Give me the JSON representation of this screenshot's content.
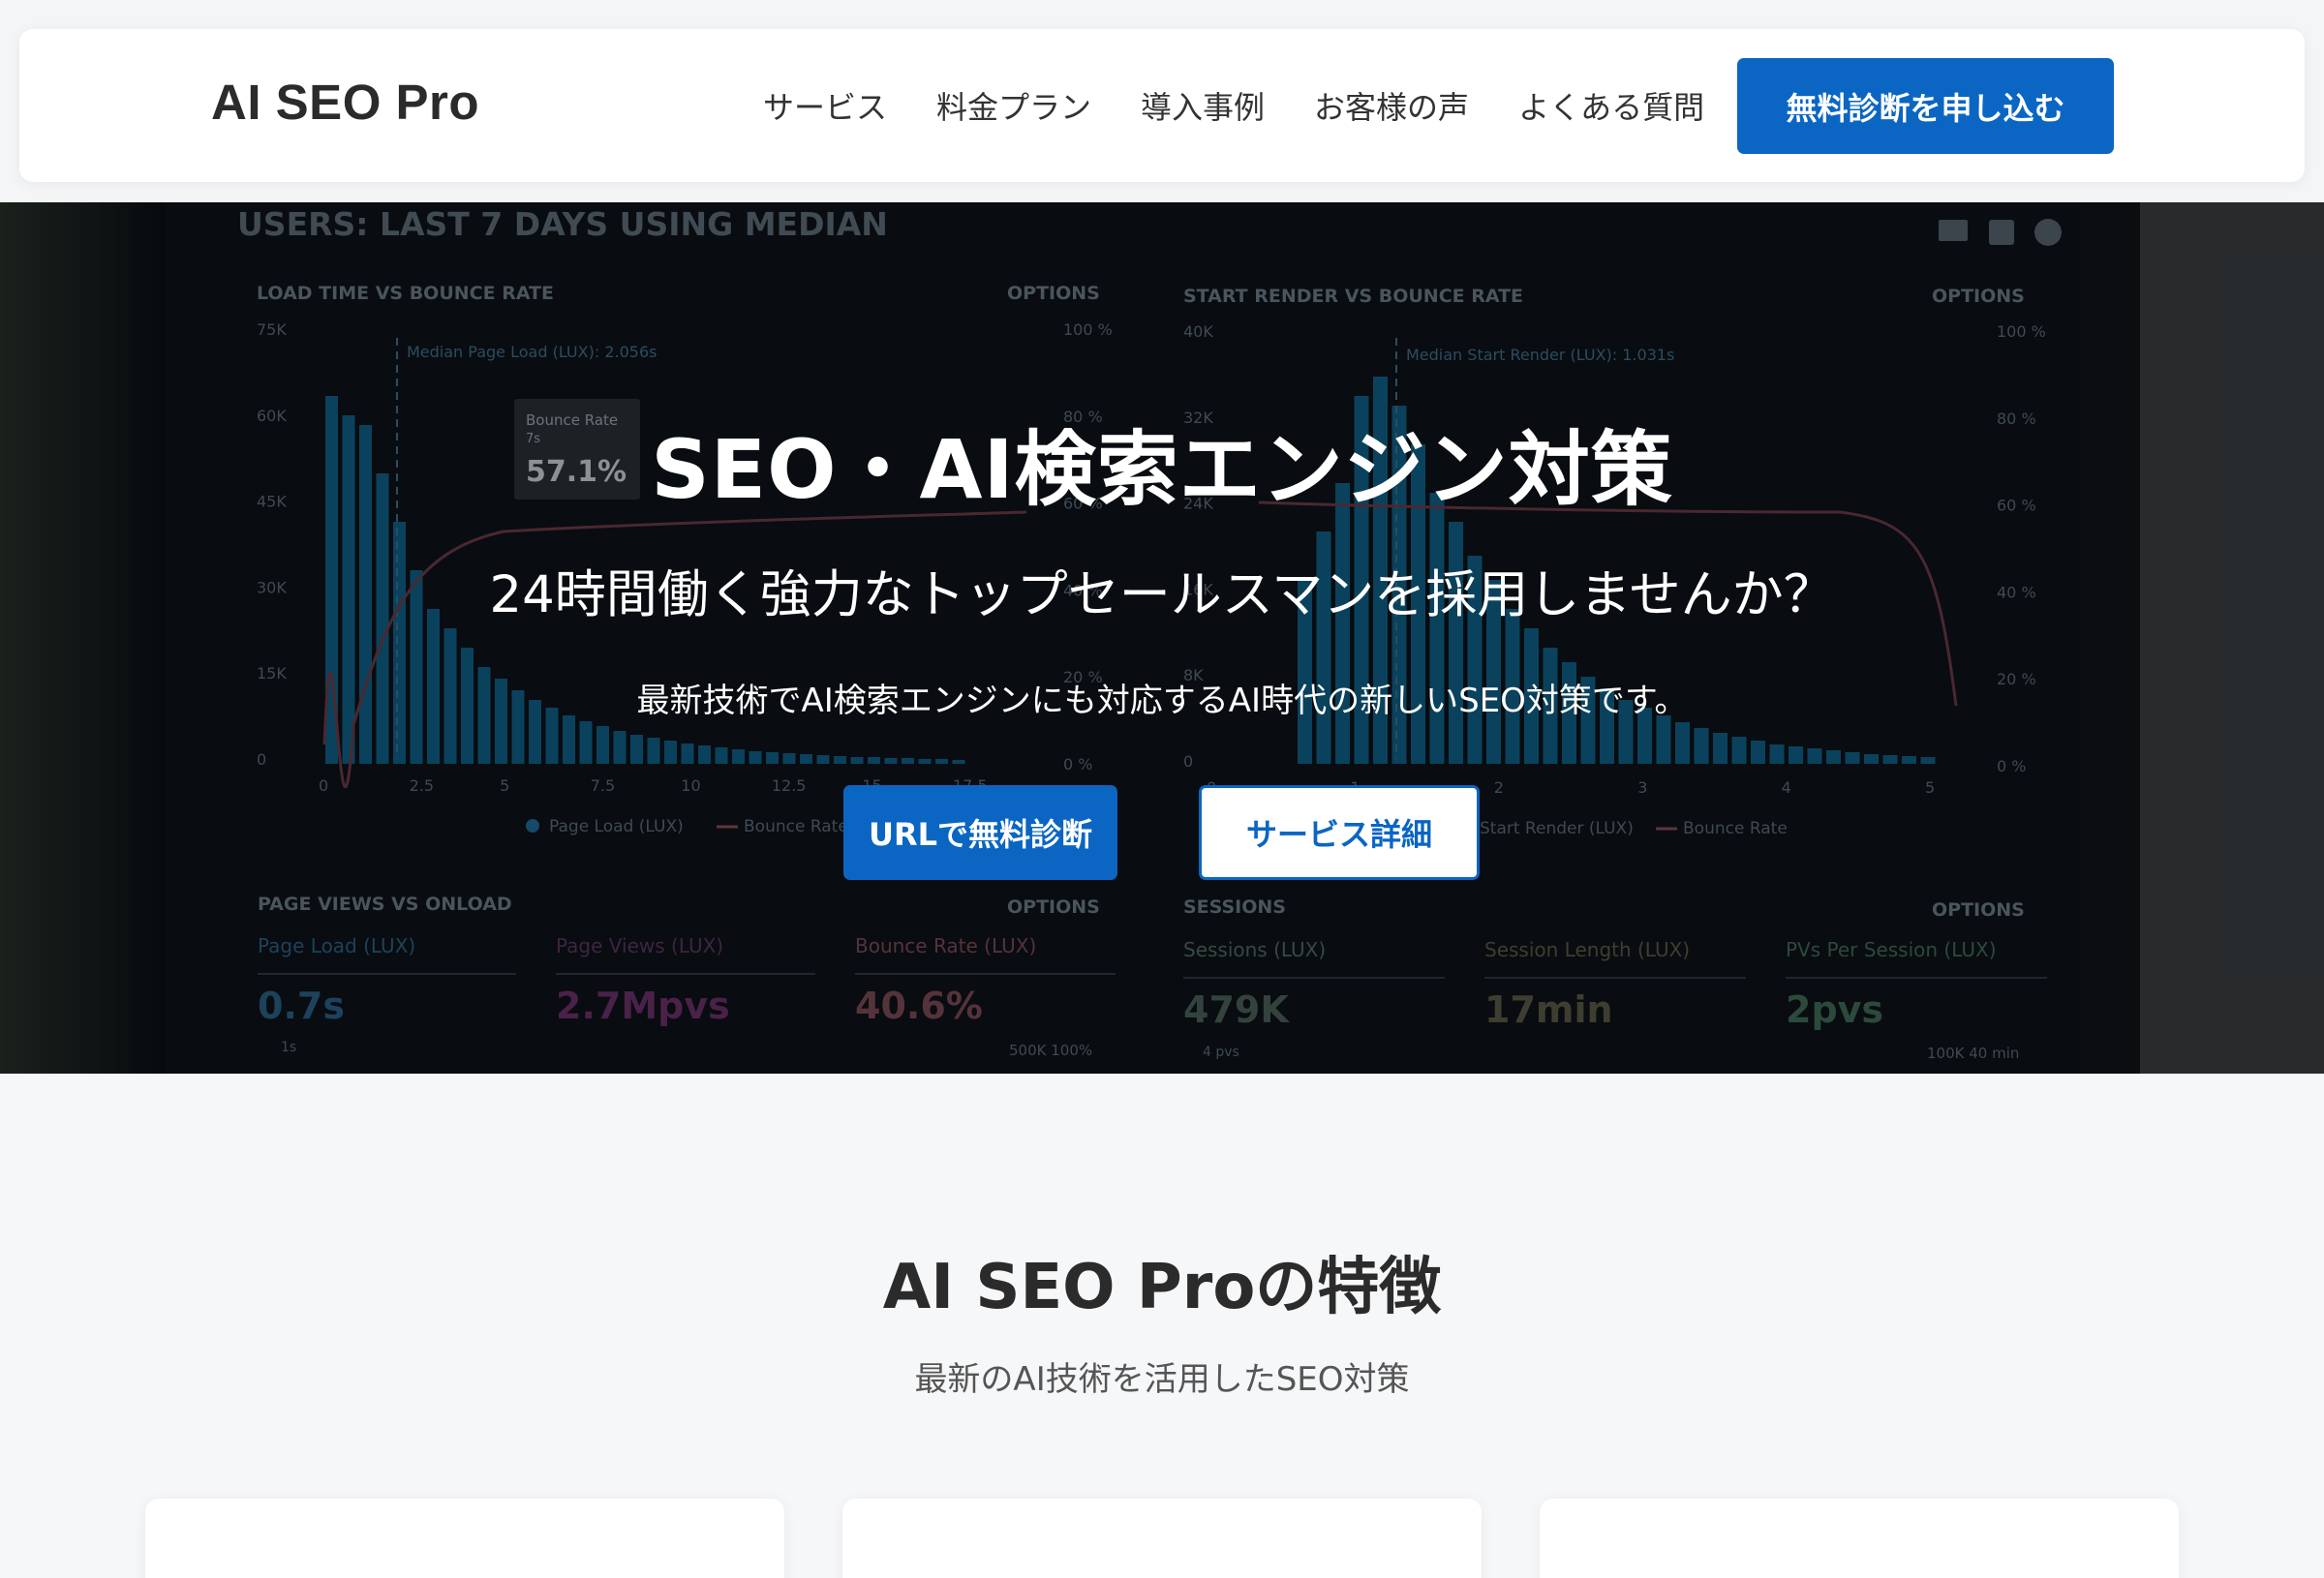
{
  "header": {
    "logo": "AI SEO Pro",
    "nav": [
      "サービス",
      "料金プラン",
      "導入事例",
      "お客様の声",
      "よくある質問"
    ],
    "cta": "無料診断を申し込む"
  },
  "hero": {
    "title": "SEO・AI検索エンジン対策",
    "subtitle": "24時間働く強力なトップセールスマンを採用しませんか？",
    "description": "最新技術でAI検索エンジンにも対応するAI時代の新しいSEO対策です。",
    "primary_button": "URLで無料診断",
    "secondary_button": "サービス詳細",
    "background": {
      "header": "USERS: LAST 7 DAYS USING MEDIAN",
      "panel_left": {
        "title": "LOAD TIME VS BOUNCE RATE",
        "options": "OPTIONS",
        "median": "Median Page Load (LUX): 2.056s",
        "tooltip_label": "Bounce Rate",
        "tooltip_sub": "7s",
        "tooltip_value": "57.1%",
        "y_ticks": [
          "75K",
          "60K",
          "45K",
          "30K",
          "15K",
          "0"
        ],
        "y2_ticks": [
          "100 %",
          "80 %",
          "60 %",
          "40 %",
          "20 %",
          "0 %"
        ],
        "x_ticks": [
          "0",
          "2.5",
          "5",
          "7.5",
          "10",
          "12.5",
          "15",
          "17.5"
        ],
        "legend": [
          "Page Load (LUX)",
          "Bounce Rate"
        ]
      },
      "panel_right": {
        "title": "START RENDER VS BOUNCE RATE",
        "options": "OPTIONS",
        "median": "Median Start Render (LUX): 1.031s",
        "y_ticks": [
          "40K",
          "32K",
          "24K",
          "16K",
          "8K",
          "0"
        ],
        "y2_ticks": [
          "100 %",
          "80 %",
          "60 %",
          "40 %",
          "20 %",
          "0 %"
        ],
        "x_ticks": [
          "0",
          "1",
          "2",
          "3",
          "4",
          "5"
        ],
        "legend": [
          "Start Render (LUX)",
          "Bounce Rate"
        ]
      },
      "bottom_left": {
        "title": "PAGE VIEWS VS ONLOAD",
        "options": "OPTIONS",
        "stats": [
          {
            "label": "Page Load (LUX)",
            "value": "0.7s",
            "sub": "1s"
          },
          {
            "label": "Page Views (LUX)",
            "value": "2.7Mpvs",
            "sub": ""
          },
          {
            "label": "Bounce Rate (LUX)",
            "value": "40.6%",
            "sub": "500K  100%"
          }
        ]
      },
      "bottom_right": {
        "title": "SESSIONS",
        "options": "OPTIONS",
        "stats": [
          {
            "label": "Sessions (LUX)",
            "value": "479K",
            "sub": "4 pvs"
          },
          {
            "label": "Session Length (LUX)",
            "value": "17min",
            "sub": ""
          },
          {
            "label": "PVs Per Session (LUX)",
            "value": "2pvs",
            "sub": "100K  40 min"
          }
        ]
      },
      "colors": {
        "bars": "#0f5f86",
        "bounce_line": "#8a4a58",
        "stat_blue": "#2a5f85",
        "stat_purple": "#7a3a7a",
        "stat_pink": "#8a4a58",
        "stat_green": "#3e6a55"
      }
    }
  },
  "features": {
    "title": "AI SEO Proの特徴",
    "subtitle": "最新のAI技術を活用したSEO対策"
  },
  "colors": {
    "accent": "#0a66c2",
    "page_bg": "#f6f7f9"
  }
}
